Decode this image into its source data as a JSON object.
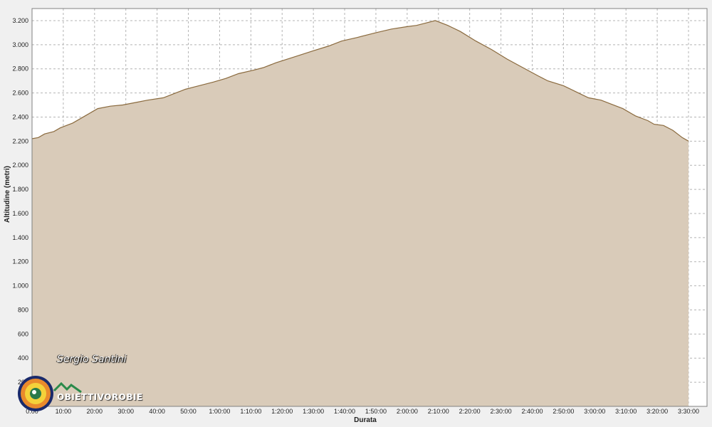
{
  "chart_data": {
    "type": "area",
    "xlabel": "Durata",
    "ylabel": "Altitudine (metri)",
    "xlim_seconds": [
      0,
      12600
    ],
    "ylim": [
      0,
      3300
    ],
    "grid": true,
    "legend": "none",
    "x_ticks": [
      {
        "v": 0,
        "label": "0:00"
      },
      {
        "v": 600,
        "label": "10:00"
      },
      {
        "v": 1200,
        "label": "20:00"
      },
      {
        "v": 1800,
        "label": "30:00"
      },
      {
        "v": 2400,
        "label": "40:00"
      },
      {
        "v": 3000,
        "label": "50:00"
      },
      {
        "v": 3600,
        "label": "1:00:00"
      },
      {
        "v": 4200,
        "label": "1:10:00"
      },
      {
        "v": 4800,
        "label": "1:20:00"
      },
      {
        "v": 5400,
        "label": "1:30:00"
      },
      {
        "v": 6000,
        "label": "1:40:00"
      },
      {
        "v": 6600,
        "label": "1:50:00"
      },
      {
        "v": 7200,
        "label": "2:00:00"
      },
      {
        "v": 7800,
        "label": "2:10:00"
      },
      {
        "v": 8400,
        "label": "2:20:00"
      },
      {
        "v": 9000,
        "label": "2:30:00"
      },
      {
        "v": 9600,
        "label": "2:40:00"
      },
      {
        "v": 10200,
        "label": "2:50:00"
      },
      {
        "v": 10800,
        "label": "3:00:00"
      },
      {
        "v": 11400,
        "label": "3:10:00"
      },
      {
        "v": 12000,
        "label": "3:20:00"
      },
      {
        "v": 12600,
        "label": "3:30:00"
      }
    ],
    "y_ticks": [
      {
        "v": 200,
        "label": "200"
      },
      {
        "v": 400,
        "label": "400"
      },
      {
        "v": 600,
        "label": "600"
      },
      {
        "v": 800,
        "label": "800"
      },
      {
        "v": 1000,
        "label": "1.000"
      },
      {
        "v": 1200,
        "label": "1.200"
      },
      {
        "v": 1400,
        "label": "1.400"
      },
      {
        "v": 1600,
        "label": "1.600"
      },
      {
        "v": 1800,
        "label": "1.800"
      },
      {
        "v": 2000,
        "label": "2.000"
      },
      {
        "v": 2200,
        "label": "2.200"
      },
      {
        "v": 2400,
        "label": "2.400"
      },
      {
        "v": 2600,
        "label": "2.600"
      },
      {
        "v": 2800,
        "label": "2.800"
      },
      {
        "v": 3000,
        "label": "3.000"
      },
      {
        "v": 3200,
        "label": "3.200"
      }
    ],
    "series": [
      {
        "x_seconds": [
          0,
          120,
          240,
          420,
          540,
          780,
          1020,
          1140,
          1260,
          1500,
          1740,
          1980,
          2220,
          2520,
          2760,
          2940,
          3120,
          3480,
          3720,
          3960,
          4260,
          4440,
          4680,
          5040,
          5400,
          5700,
          5940,
          6240,
          6600,
          6900,
          7200,
          7380,
          7560,
          7740,
          7980,
          8220,
          8520,
          8820,
          9120,
          9420,
          9720,
          9900,
          10200,
          10440,
          10680,
          10920,
          11100,
          11340,
          11580,
          11820,
          11940,
          12120,
          12300,
          12480,
          12600
        ],
        "y": [
          2220,
          2230,
          2260,
          2280,
          2310,
          2350,
          2410,
          2440,
          2470,
          2490,
          2500,
          2520,
          2540,
          2560,
          2600,
          2630,
          2650,
          2690,
          2720,
          2760,
          2790,
          2810,
          2850,
          2900,
          2950,
          2990,
          3030,
          3060,
          3100,
          3130,
          3150,
          3160,
          3180,
          3200,
          3160,
          3110,
          3030,
          2960,
          2880,
          2810,
          2740,
          2700,
          2660,
          2610,
          2560,
          2540,
          2510,
          2470,
          2410,
          2370,
          2340,
          2330,
          2290,
          2230,
          2200
        ]
      }
    ]
  },
  "watermark": {
    "author": "Sergio Santini",
    "logo_text": "OBIETTIVOROBIE"
  },
  "colors": {
    "fill": "#d9cbb9",
    "line": "#8a6a3e",
    "grid": "#b4b4b4",
    "plot_bg": "#ffffff",
    "frame_bg": "#f0f0f0"
  }
}
